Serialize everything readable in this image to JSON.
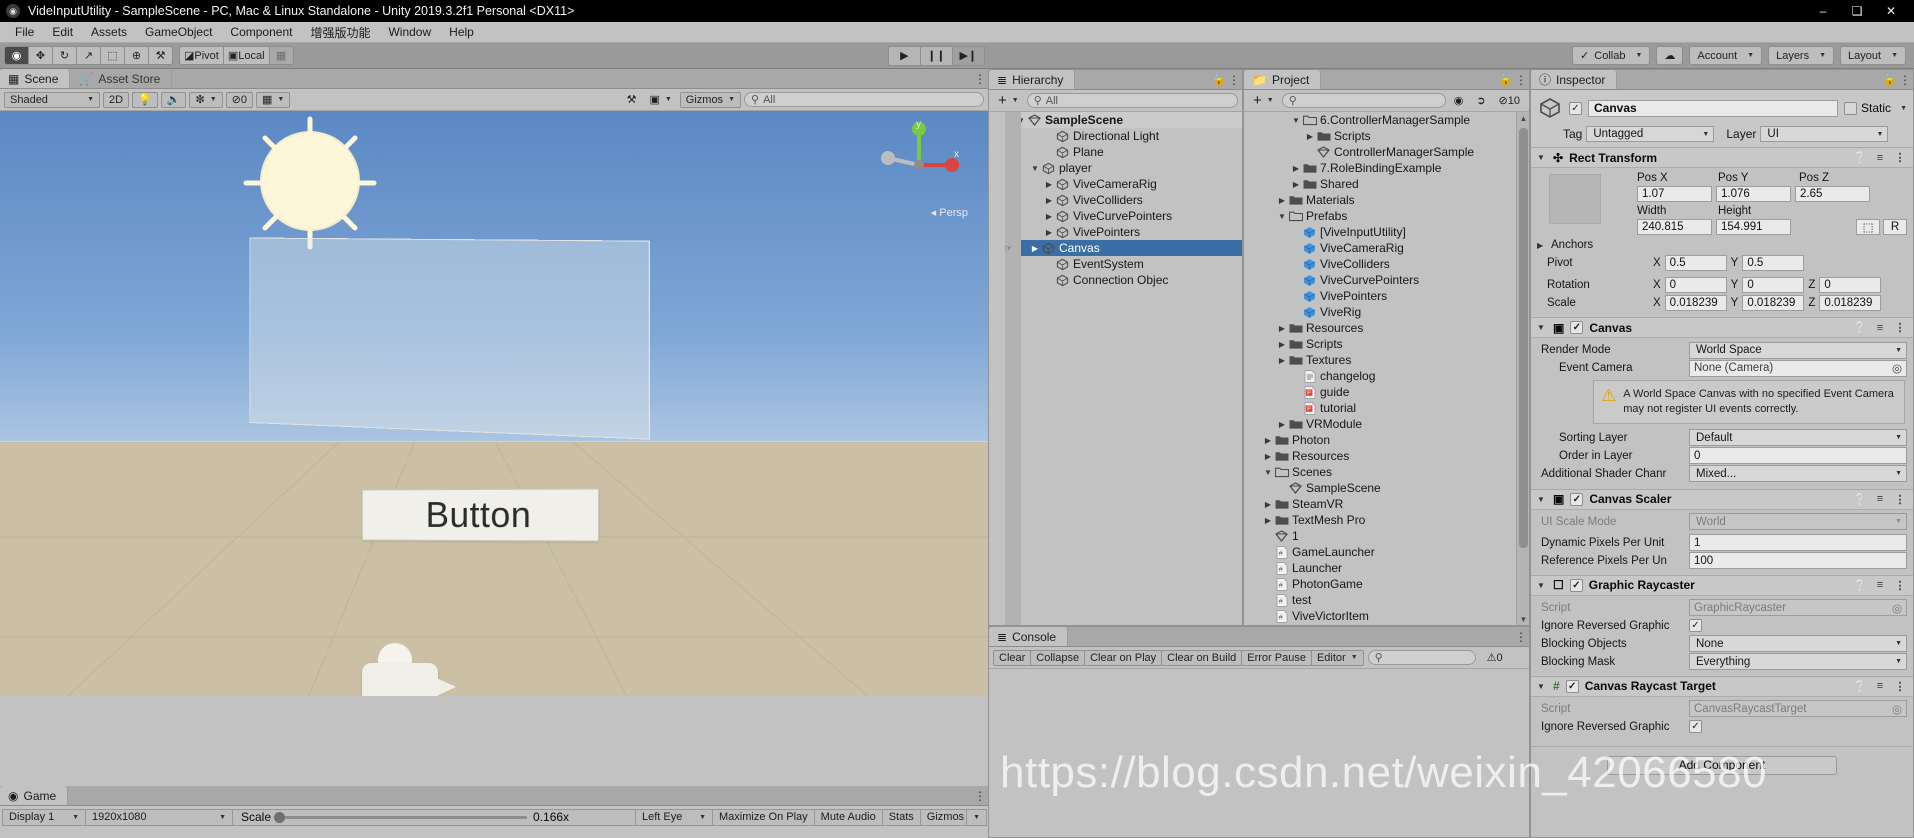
{
  "window": {
    "title": "VideInputUtility - SampleScene - PC, Mac & Linux Standalone - Unity 2019.3.2f1 Personal <DX11>",
    "minimize": "–",
    "maximize": "❑",
    "close": "✕"
  },
  "menubar": {
    "items": [
      "File",
      "Edit",
      "Assets",
      "GameObject",
      "Component",
      "增强版功能",
      "Window",
      "Help"
    ]
  },
  "toolbar": {
    "tools": [
      {
        "name": "hand-tool",
        "glyph": "◉",
        "active": true
      },
      {
        "name": "move-tool",
        "glyph": "✥",
        "active": false
      },
      {
        "name": "rotate-tool",
        "glyph": "↻",
        "active": false
      },
      {
        "name": "scale-tool",
        "glyph": "↗",
        "active": false
      },
      {
        "name": "rect-tool",
        "glyph": "⬚",
        "active": false
      },
      {
        "name": "transform-tool",
        "glyph": "⊕",
        "active": false
      },
      {
        "name": "custom-tool",
        "glyph": "⚒",
        "active": false
      }
    ],
    "pivot_label": "Pivot",
    "local_label": "Local",
    "grid_snap_glyph": "▦",
    "play": "▶",
    "pause": "❙❙",
    "step": "▶❙",
    "collab_label": "Collab",
    "cloud_glyph": "☁",
    "account_label": "Account",
    "layers_label": "Layers",
    "layout_label": "Layout"
  },
  "scene": {
    "tabs": [
      {
        "label": "Scene",
        "icon": "grid-icon",
        "active": true
      },
      {
        "label": "Asset Store",
        "icon": "store-icon",
        "active": false
      }
    ],
    "shading_mode": "Shaded",
    "two_d_label": "2D",
    "light_glyph": "Ὂ1",
    "audio_glyph": "ὐA",
    "fx_glyph": "❇",
    "hidden_count": "0",
    "grid_glyph": "⚌",
    "gizmos_label": "Gizmos",
    "search_placeholder": "All",
    "button_label": "Button",
    "persp_label": "Persp",
    "axis_y": "y",
    "axis_x": "x"
  },
  "game": {
    "tab_label": "Game",
    "display": "Display 1",
    "resolution": "1920x1080",
    "scale_label": "Scale",
    "scale_value": "0.166x",
    "eye": "Left Eye",
    "maximize": "Maximize On Play",
    "mute": "Mute Audio",
    "stats": "Stats",
    "gizmos": "Gizmos"
  },
  "hierarchy": {
    "tab_label": "Hierarchy",
    "add_label": "+",
    "search_placeholder": "All",
    "items": [
      {
        "label": "SampleScene",
        "depth": 0,
        "arrow": "down",
        "icon": "scene-icon",
        "root": true
      },
      {
        "label": "Directional Light",
        "depth": 2,
        "arrow": "none",
        "icon": "gameobject-icon"
      },
      {
        "label": "Plane",
        "depth": 2,
        "arrow": "none",
        "icon": "gameobject-icon"
      },
      {
        "label": "player",
        "depth": 1,
        "arrow": "down",
        "icon": "gameobject-icon"
      },
      {
        "label": "ViveCameraRig",
        "depth": 2,
        "arrow": "right",
        "icon": "gameobject-icon"
      },
      {
        "label": "ViveColliders",
        "depth": 2,
        "arrow": "right",
        "icon": "gameobject-icon"
      },
      {
        "label": "ViveCurvePointers",
        "depth": 2,
        "arrow": "right",
        "icon": "gameobject-icon"
      },
      {
        "label": "VivePointers",
        "depth": 2,
        "arrow": "right",
        "icon": "gameobject-icon"
      },
      {
        "label": "Canvas",
        "depth": 1,
        "arrow": "right",
        "icon": "gameobject-icon",
        "selected": true
      },
      {
        "label": "EventSystem",
        "depth": 2,
        "arrow": "none",
        "icon": "gameobject-icon"
      },
      {
        "label": "Connection Objec",
        "depth": 2,
        "arrow": "none",
        "icon": "gameobject-icon"
      }
    ]
  },
  "project": {
    "tab_label": "Project",
    "add_label": "+",
    "search_placeholder": "",
    "visible_count": "10",
    "items": [
      {
        "label": "6.ControllerManagerSample",
        "depth": 3,
        "arrow": "down",
        "icon": "folder-open-icon"
      },
      {
        "label": "Scripts",
        "depth": 4,
        "arrow": "right",
        "icon": "folder-icon"
      },
      {
        "label": "ControllerManagerSample",
        "depth": 4,
        "arrow": "none",
        "icon": "scene-icon"
      },
      {
        "label": "7.RoleBindingExample",
        "depth": 3,
        "arrow": "right",
        "icon": "folder-icon"
      },
      {
        "label": "Shared",
        "depth": 3,
        "arrow": "right",
        "icon": "folder-icon"
      },
      {
        "label": "Materials",
        "depth": 2,
        "arrow": "right",
        "icon": "folder-icon"
      },
      {
        "label": "Prefabs",
        "depth": 2,
        "arrow": "down",
        "icon": "folder-open-icon"
      },
      {
        "label": "[ViveInputUtility]",
        "depth": 3,
        "arrow": "none",
        "icon": "prefab-icon"
      },
      {
        "label": "ViveCameraRig",
        "depth": 3,
        "arrow": "none",
        "icon": "prefab-icon"
      },
      {
        "label": "ViveColliders",
        "depth": 3,
        "arrow": "none",
        "icon": "prefab-icon"
      },
      {
        "label": "ViveCurvePointers",
        "depth": 3,
        "arrow": "none",
        "icon": "prefab-icon"
      },
      {
        "label": "VivePointers",
        "depth": 3,
        "arrow": "none",
        "icon": "prefab-icon"
      },
      {
        "label": "ViveRig",
        "depth": 3,
        "arrow": "none",
        "icon": "prefab-icon"
      },
      {
        "label": "Resources",
        "depth": 2,
        "arrow": "right",
        "icon": "folder-icon"
      },
      {
        "label": "Scripts",
        "depth": 2,
        "arrow": "right",
        "icon": "folder-icon"
      },
      {
        "label": "Textures",
        "depth": 2,
        "arrow": "right",
        "icon": "folder-icon"
      },
      {
        "label": "changelog",
        "depth": 3,
        "arrow": "none",
        "icon": "text-icon"
      },
      {
        "label": "guide",
        "depth": 3,
        "arrow": "none",
        "icon": "pdf-icon"
      },
      {
        "label": "tutorial",
        "depth": 3,
        "arrow": "none",
        "icon": "pdf-icon"
      },
      {
        "label": "VRModule",
        "depth": 2,
        "arrow": "right",
        "icon": "folder-icon"
      },
      {
        "label": "Photon",
        "depth": 1,
        "arrow": "right",
        "icon": "folder-icon"
      },
      {
        "label": "Resources",
        "depth": 1,
        "arrow": "right",
        "icon": "folder-icon"
      },
      {
        "label": "Scenes",
        "depth": 1,
        "arrow": "down",
        "icon": "folder-open-icon"
      },
      {
        "label": "SampleScene",
        "depth": 2,
        "arrow": "none",
        "icon": "scene-icon"
      },
      {
        "label": "SteamVR",
        "depth": 1,
        "arrow": "right",
        "icon": "folder-icon"
      },
      {
        "label": "TextMesh Pro",
        "depth": 1,
        "arrow": "right",
        "icon": "folder-icon"
      },
      {
        "label": "1",
        "depth": 1,
        "arrow": "none",
        "icon": "scene-icon"
      },
      {
        "label": "GameLauncher",
        "depth": 1,
        "arrow": "none",
        "icon": "script-icon"
      },
      {
        "label": "Launcher",
        "depth": 1,
        "arrow": "none",
        "icon": "script-icon"
      },
      {
        "label": "PhotonGame",
        "depth": 1,
        "arrow": "none",
        "icon": "script-icon"
      },
      {
        "label": "test",
        "depth": 1,
        "arrow": "none",
        "icon": "script-icon"
      },
      {
        "label": "ViveVictorItem",
        "depth": 1,
        "arrow": "none",
        "icon": "script-icon"
      }
    ]
  },
  "console": {
    "tab_label": "Console",
    "buttons": [
      "Clear",
      "Collapse",
      "Clear on Play",
      "Clear on Build",
      "Error Pause"
    ],
    "editor_label": "Editor",
    "search_placeholder": "",
    "error_count": "0"
  },
  "inspector": {
    "tab_label": "Inspector",
    "object_name": "Canvas",
    "static_label": "Static",
    "tag_label": "Tag",
    "tag_value": "Untagged",
    "layer_label": "Layer",
    "layer_value": "UI",
    "add_component": "Add Component",
    "rect_transform": {
      "title": "Rect Transform",
      "pos_x_label": "Pos X",
      "pos_y_label": "Pos Y",
      "pos_z_label": "Pos Z",
      "pos_x": "1.07",
      "pos_y": "1.076",
      "pos_z": "2.65",
      "width_label": "Width",
      "height_label": "Height",
      "width": "240.815",
      "height": "154.991",
      "blueprint_glyph": "⬚",
      "raw_label": "R",
      "anchors_label": "Anchors",
      "pivot_label": "Pivot",
      "pivot_x": "0.5",
      "pivot_y": "0.5",
      "rotation_label": "Rotation",
      "rot_x": "0",
      "rot_y": "0",
      "rot_z": "0",
      "scale_label": "Scale",
      "scale_x": "0.018239",
      "scale_y": "0.018239",
      "scale_z": "0.018239",
      "axis_x": "X",
      "axis_y": "Y",
      "axis_z": "Z"
    },
    "canvas": {
      "title": "Canvas",
      "render_mode_label": "Render Mode",
      "render_mode_value": "World Space",
      "event_camera_label": "Event Camera",
      "event_camera_value": "None (Camera)",
      "warning": "A World Space Canvas with no specified Event Camera may not register UI events correctly.",
      "sorting_layer_label": "Sorting Layer",
      "sorting_layer_value": "Default",
      "order_in_layer_label": "Order in Layer",
      "order_in_layer_value": "0",
      "shader_channels_label": "Additional Shader Chanr",
      "shader_channels_value": "Mixed..."
    },
    "canvas_scaler": {
      "title": "Canvas Scaler",
      "ui_scale_mode_label": "UI Scale Mode",
      "ui_scale_mode_value": "World",
      "dynamic_ppu_label": "Dynamic Pixels Per Unit",
      "dynamic_ppu_value": "1",
      "reference_ppu_label": "Reference Pixels Per Un",
      "reference_ppu_value": "100"
    },
    "graphic_raycaster": {
      "title": "Graphic Raycaster",
      "script_label": "Script",
      "script_value": "GraphicRaycaster",
      "ignore_reversed_label": "Ignore Reversed Graphic",
      "blocking_objects_label": "Blocking Objects",
      "blocking_objects_value": "None",
      "blocking_mask_label": "Blocking Mask",
      "blocking_mask_value": "Everything"
    },
    "canvas_raycast_target": {
      "title": "Canvas Raycast Target",
      "script_label": "Script",
      "script_value": "CanvasRaycastTarget",
      "ignore_reversed_label": "Ignore Reversed Graphic"
    }
  },
  "watermark": {
    "text": "https://blog.csdn.net/weixin_42066580"
  }
}
